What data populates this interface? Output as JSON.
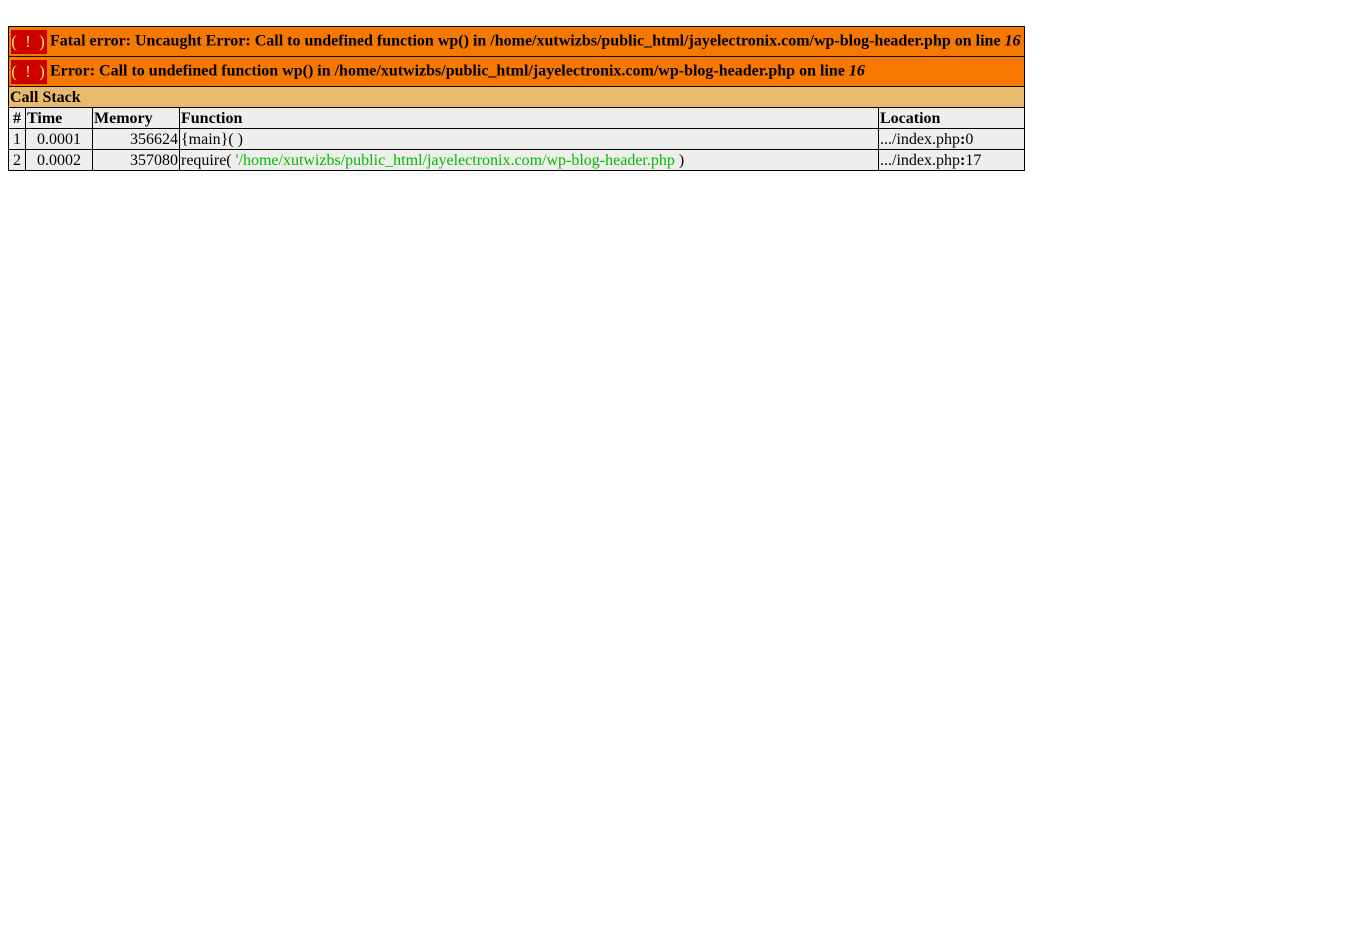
{
  "errors": [
    {
      "icon": "( ! )",
      "message": "Fatal error: Uncaught Error: Call to undefined function wp() in /home/xutwizbs/public_html/jayelectronix.com/wp-blog-header.php on line ",
      "line": "16"
    },
    {
      "icon": "( ! )",
      "message": "Error: Call to undefined function wp() in /home/xutwizbs/public_html/jayelectronix.com/wp-blog-header.php on line ",
      "line": "16"
    }
  ],
  "call_stack": {
    "title": "Call Stack",
    "headers": [
      "#",
      "Time",
      "Memory",
      "Function",
      "Location"
    ],
    "rows": [
      {
        "num": "1",
        "time": "0.0001",
        "memory": "356624",
        "function": "{main}( )",
        "function_arg": "",
        "function_close": "",
        "location_file": ".../index.php",
        "location_sep": ":",
        "location_line": "0"
      },
      {
        "num": "2",
        "time": "0.0002",
        "memory": "357080",
        "function": "require( ",
        "function_arg": "'/home/xutwizbs/public_html/jayelectronix.com/wp-blog-header.php",
        "function_close": " )",
        "location_file": ".../index.php",
        "location_sep": ":",
        "location_line": "17"
      }
    ]
  },
  "colors": {
    "error_bg": "#f57900",
    "stack_title_bg": "#e9b96e",
    "row_bg": "#eeeeec",
    "icon_bg": "#cc0000",
    "icon_fg": "#fce94f",
    "file_arg": "#00bb00"
  }
}
